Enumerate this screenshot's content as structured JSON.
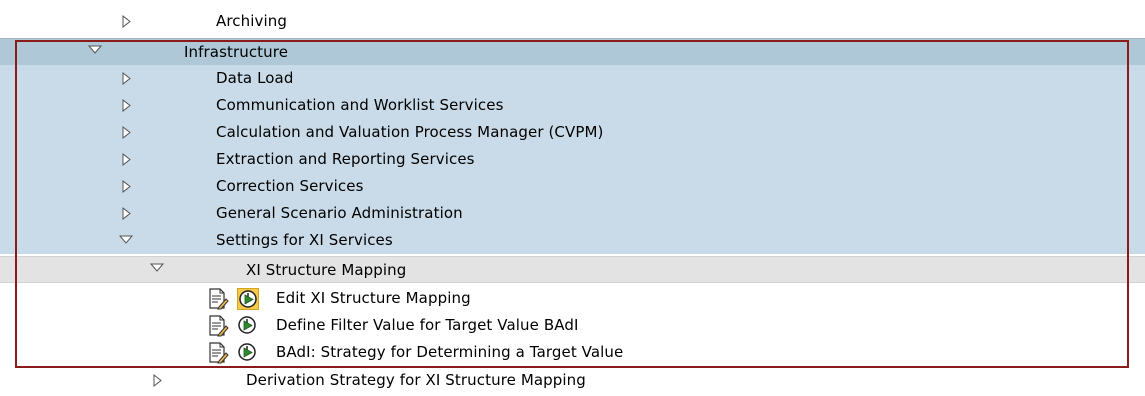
{
  "tree": {
    "archiving": {
      "label": "Archiving"
    },
    "infrastructure": {
      "label": "Infrastructure"
    },
    "data_load": {
      "label": "Data Load"
    },
    "communication": {
      "label": "Communication and Worklist Services"
    },
    "cvpm": {
      "label": "Calculation and Valuation Process Manager (CVPM)"
    },
    "extraction": {
      "label": "Extraction and Reporting Services"
    },
    "correction": {
      "label": "Correction Services"
    },
    "general_scenario": {
      "label": "General Scenario Administration"
    },
    "xi_settings": {
      "label": "Settings for XI Services"
    },
    "xi_structure_mapping": {
      "label": "XI Structure Mapping"
    },
    "activities": [
      {
        "label": "Edit XI Structure Mapping",
        "highlighted": true
      },
      {
        "label": "Define Filter Value for Target Value BAdI",
        "highlighted": false
      },
      {
        "label": "BAdI: Strategy for Determining a Target Value",
        "highlighted": false
      }
    ],
    "derivation": {
      "label": "Derivation Strategy for XI Structure Mapping"
    }
  },
  "icons": {
    "collapsed": "triangle-right-icon",
    "expanded": "triangle-down-icon",
    "documentation": "documentation-icon",
    "execute": "execute-clock-icon"
  },
  "colors": {
    "row_blue": "#c9dbe8",
    "row_selected": "#aec8d8",
    "row_grey": "#e3e3e3",
    "frame": "#8b1a1a",
    "highlight": "#f6c94a",
    "execute_green": "#2e8b2e"
  }
}
